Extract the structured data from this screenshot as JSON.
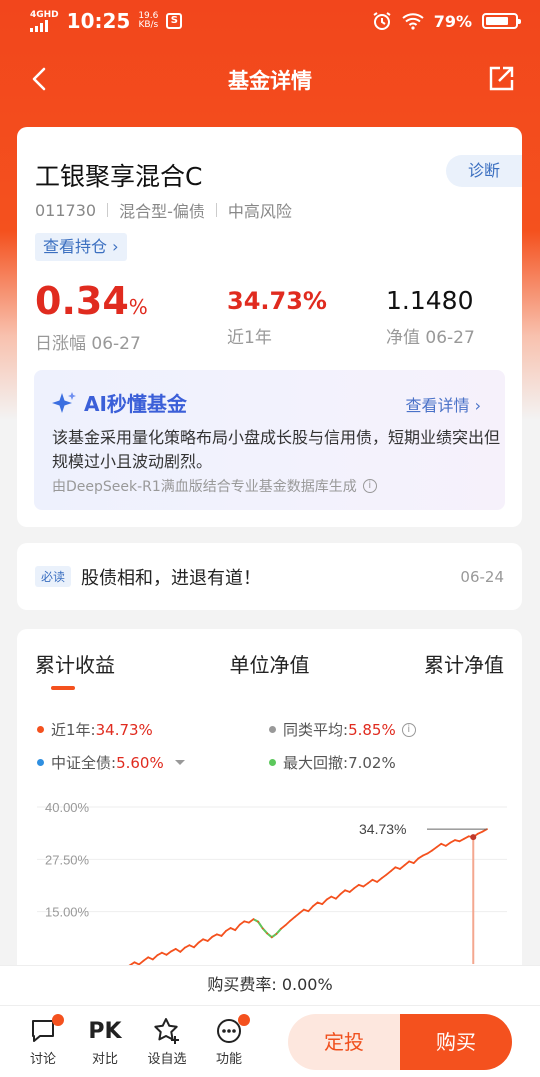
{
  "status_bar": {
    "network": "4GHD",
    "time": "10:25",
    "speed_value": "19.6",
    "speed_unit": "KB/s",
    "battery": "79%",
    "battery_level": 0.79
  },
  "nav": {
    "title": "基金详情"
  },
  "fund": {
    "name": "工银聚享混合C",
    "diagnose_label": "诊断",
    "code": "011730",
    "type": "混合型-偏债",
    "risk": "中高风险",
    "holdings_label": "查看持仓 ›",
    "daily_change_value": "0.34",
    "daily_change_unit": "%",
    "daily_change_label": "日涨幅 06-27",
    "one_year_value": "34.73%",
    "one_year_label": "近1年",
    "nav_value": "1.1480",
    "nav_label": "净值 06-27"
  },
  "ai": {
    "title": "AI秒懂基金",
    "more_label": "查看详情 ›",
    "summary": "该基金采用量化策略布局小盘成长股与信用债，短期业绩突出但规模过小且波动剧烈。",
    "source": "由DeepSeek-R1满血版结合专业基金数据库生成"
  },
  "news": {
    "badge": "必读",
    "headline": "股债相和，进退有道！",
    "date": "06-24"
  },
  "chart_tabs": [
    "累计收益",
    "单位净值",
    "累计净值"
  ],
  "legend": {
    "one_year_label": "近1年:",
    "one_year_value": "34.73%",
    "peer_label": "同类平均:",
    "peer_value": "5.85%",
    "index_label": "中证全债:",
    "index_value": "5.60%",
    "drawdown_label": "最大回撤:",
    "drawdown_value": "7.02%",
    "colors": {
      "fund": "#f4511e",
      "peer": "#999999",
      "index": "#2f8fe0",
      "drawdown": "#5cc85c"
    }
  },
  "chart_data": {
    "type": "line",
    "yticks": [
      "40.00%",
      "27.50%",
      "15.00%"
    ],
    "ylim": [
      2.5,
      40
    ],
    "annotation": "34.73%",
    "series": [
      {
        "name": "近1年",
        "values": [
          0.0,
          0.6,
          1.1,
          0.8,
          1.6,
          2.2,
          2.9,
          2.4,
          3.3,
          4.1,
          3.6,
          4.6,
          5.2,
          4.7,
          5.5,
          6.1,
          5.4,
          6.4,
          7.0,
          6.5,
          7.6,
          8.4,
          8.0,
          9.0,
          9.6,
          9.2,
          10.4,
          11.1,
          10.6,
          11.9,
          12.7,
          12.4,
          13.2,
          12.6,
          11.0,
          9.8,
          8.9,
          9.7,
          10.9,
          11.8,
          12.8,
          13.7,
          14.6,
          15.5,
          15.1,
          16.3,
          17.2,
          16.8,
          17.9,
          18.6,
          18.1,
          19.2,
          20.1,
          19.7,
          20.6,
          21.4,
          21.0,
          21.8,
          22.6,
          22.1,
          23.0,
          23.8,
          24.7,
          25.6,
          25.2,
          26.1,
          27.0,
          26.6,
          27.7,
          28.4,
          28.9,
          29.6,
          30.4,
          31.2,
          30.7,
          31.5,
          32.1,
          31.8,
          32.4,
          33.0,
          32.8,
          33.6,
          34.1,
          34.73
        ]
      }
    ],
    "drawdown_range_index": [
      32,
      38
    ]
  },
  "fee": {
    "label": "购买费率: 0.00%"
  },
  "bottom": {
    "discuss": "讨论",
    "compare_icon_text": "PK",
    "compare": "对比",
    "watch": "设自选",
    "functions": "功能",
    "dingtou": "定投",
    "buy": "购买"
  }
}
